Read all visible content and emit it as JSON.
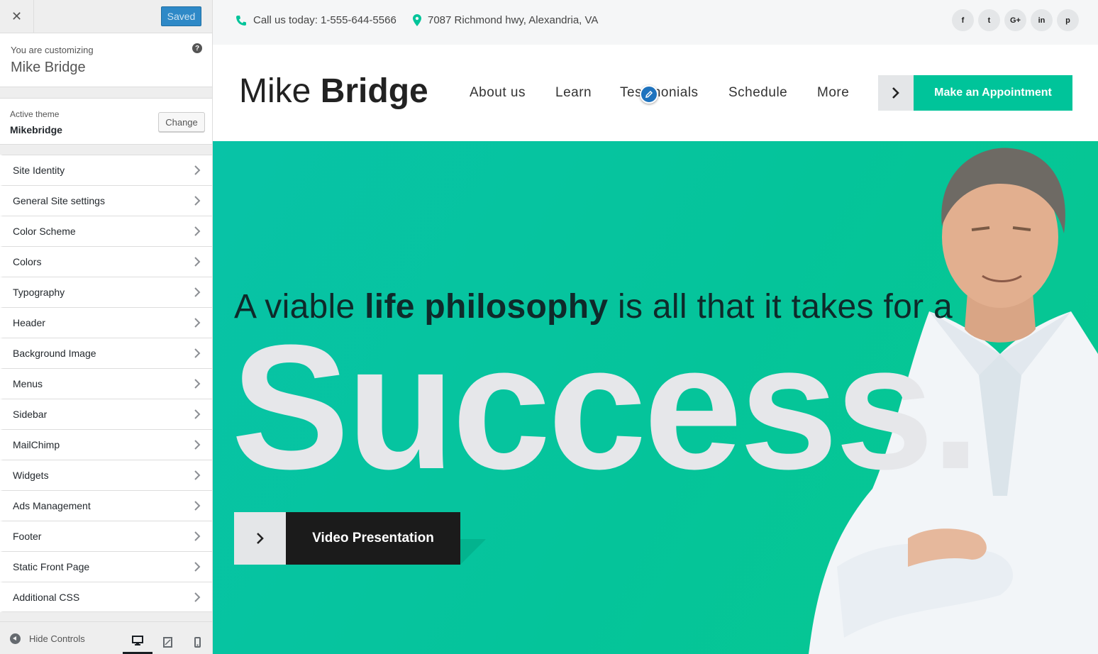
{
  "customizer": {
    "close_icon": "close-icon",
    "saved_label": "Saved",
    "customizing_label": "You are customizing",
    "site_name": "Mike Bridge",
    "help_icon": "?",
    "active_theme_label": "Active theme",
    "active_theme_name": "Mikebridge",
    "change_label": "Change",
    "sections": [
      {
        "label": "Site Identity"
      },
      {
        "label": "General Site settings"
      },
      {
        "label": "Color Scheme"
      },
      {
        "label": "Colors"
      },
      {
        "label": "Typography"
      },
      {
        "label": "Header"
      },
      {
        "label": "Background Image"
      },
      {
        "label": "Menus"
      },
      {
        "label": "Sidebar"
      },
      {
        "label": "MailChimp"
      },
      {
        "label": "Widgets"
      },
      {
        "label": "Ads Management"
      },
      {
        "label": "Footer"
      },
      {
        "label": "Static Front Page"
      },
      {
        "label": "Additional CSS"
      }
    ],
    "hide_controls_label": "Hide Controls"
  },
  "site": {
    "phone_text": "Call us today: 1-555-644-5566",
    "address_text": "7087 Richmond hwy, Alexandria, VA",
    "social": [
      "f",
      "t",
      "G+",
      "in",
      "p"
    ],
    "logo_light": "Mike",
    "logo_bold": "Bridge",
    "nav": [
      "About us",
      "Learn",
      "Testimonials",
      "Schedule",
      "More"
    ],
    "cta_label": "Make an Appointment",
    "hero": {
      "tagline_pre": "A viable",
      "tagline_bold": "life philosophy",
      "tagline_post": "is all that it takes for a",
      "headline": "Success.",
      "video_label": "Video Presentation"
    }
  },
  "colors": {
    "accent": "#00c49a",
    "saved_button": "#2e89c7",
    "dark_button": "#1b1b1b"
  }
}
